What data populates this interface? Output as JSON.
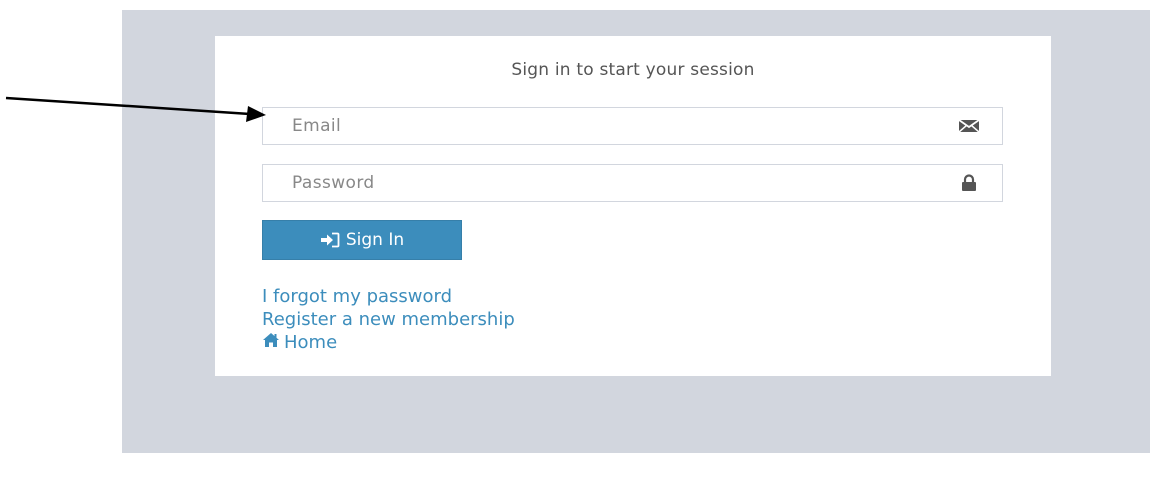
{
  "login": {
    "message": "Sign in to start your session",
    "email_placeholder": "Email",
    "password_placeholder": "Password",
    "signin_label": "Sign In",
    "forgot_link": "I forgot my password",
    "register_link": "Register a new membership",
    "home_link": "Home"
  },
  "colors": {
    "background": "#d2d6de",
    "primary": "#3c8dbc",
    "box": "#ffffff"
  },
  "icons": {
    "email": "envelope-icon",
    "password": "lock-icon",
    "signin": "sign-in-icon",
    "home": "home-icon"
  }
}
